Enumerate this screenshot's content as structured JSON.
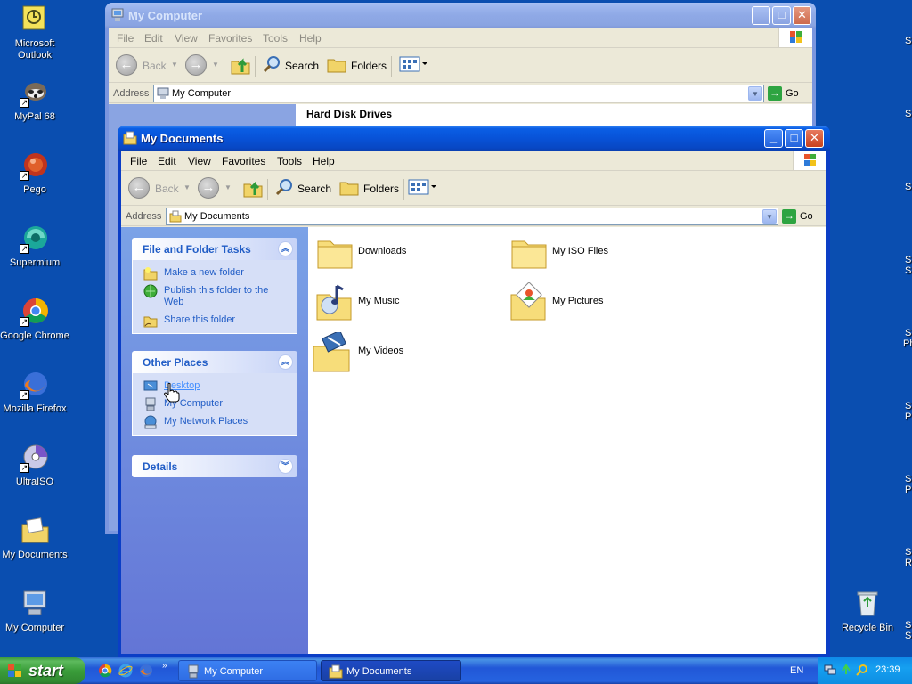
{
  "desktop": {
    "icons": [
      {
        "label": "Microsoft Outlook",
        "icon": "outlook-icon"
      },
      {
        "label": "MyPal 68",
        "icon": "mypal-icon"
      },
      {
        "label": "Pego",
        "icon": "pego-icon"
      },
      {
        "label": "Supermium",
        "icon": "supermium-icon"
      },
      {
        "label": "Google Chrome",
        "icon": "chrome-icon"
      },
      {
        "label": "Mozilla Firefox",
        "icon": "firefox-icon"
      },
      {
        "label": "UltraISO",
        "icon": "ultraiso-icon"
      },
      {
        "label": "My Documents",
        "icon": "my-documents-icon"
      },
      {
        "label": "My Computer",
        "icon": "my-computer-icon"
      },
      {
        "label": "Recycle Bin",
        "icon": "recycle-bin-icon"
      }
    ],
    "right_edge_fragments": [
      "S",
      "S",
      "S",
      "S",
      "S",
      "N",
      "S",
      "Ph",
      "S",
      "P",
      "S",
      "P",
      "S",
      "R",
      "S",
      "S"
    ]
  },
  "window_back": {
    "title": "My Computer",
    "menu": [
      "File",
      "Edit",
      "View",
      "Favorites",
      "Tools",
      "Help"
    ],
    "toolbar": {
      "back": "Back",
      "search": "Search",
      "folders": "Folders"
    },
    "address_label": "Address",
    "address_value": "My Computer",
    "go_label": "Go",
    "section": "Hard Disk Drives"
  },
  "window_front": {
    "title": "My Documents",
    "menu": [
      "File",
      "Edit",
      "View",
      "Favorites",
      "Tools",
      "Help"
    ],
    "toolbar": {
      "back": "Back",
      "search": "Search",
      "folders": "Folders"
    },
    "address_label": "Address",
    "address_value": "My Documents",
    "go_label": "Go",
    "panels": {
      "file_tasks": {
        "title": "File and Folder Tasks",
        "items": [
          "Make a new folder",
          "Publish this folder to the Web",
          "Share this folder"
        ]
      },
      "other_places": {
        "title": "Other Places",
        "items": [
          "Desktop",
          "My Computer",
          "My Network Places"
        ]
      },
      "details": {
        "title": "Details"
      }
    },
    "files": [
      {
        "name": "Downloads",
        "icon": "folder-icon"
      },
      {
        "name": "My ISO Files",
        "icon": "folder-icon"
      },
      {
        "name": "My Music",
        "icon": "music-folder-icon"
      },
      {
        "name": "My Pictures",
        "icon": "pictures-folder-icon"
      },
      {
        "name": "My Videos",
        "icon": "videos-folder-icon"
      }
    ]
  },
  "taskbar": {
    "start_label": "start",
    "quick_launch_more": "»",
    "tasks": [
      {
        "label": "My Computer",
        "active": false
      },
      {
        "label": "My Documents",
        "active": true
      }
    ],
    "language": "EN",
    "clock": "23:39"
  },
  "colors": {
    "desktop": "#0a4eb0",
    "title_active": "#0853d8",
    "task_link": "#215dc6",
    "start_green": "#3a9d3a"
  }
}
